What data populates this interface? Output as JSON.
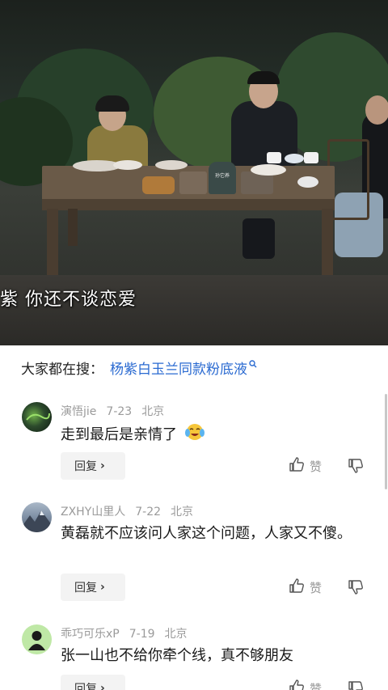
{
  "video": {
    "subtitle": "紫  你还不谈恋爱",
    "table_sign": "孙它养"
  },
  "search": {
    "prefix": "大家都在搜：",
    "link": "杨紫白玉兰同款粉底液"
  },
  "comments": [
    {
      "username": "演悟jie",
      "date": "7-23",
      "location": "北京",
      "text": "走到最后是亲情了",
      "reply_label": "回复",
      "like_label": "赞"
    },
    {
      "username": "ZXHY山里人",
      "date": "7-22",
      "location": "北京",
      "text": "黄磊就不应该问人家这个问题，人家又不傻。",
      "reply_label": "回复",
      "like_label": "赞"
    },
    {
      "username": "乖巧可乐xP",
      "date": "7-19",
      "location": "北京",
      "text": "张一山也不给你牵个线，真不够朋友",
      "reply_label": "回复",
      "like_label": "赞"
    }
  ],
  "colors": {
    "link": "#2a6ad1",
    "meta": "#9a9a9a",
    "text": "#1a1a1a"
  }
}
